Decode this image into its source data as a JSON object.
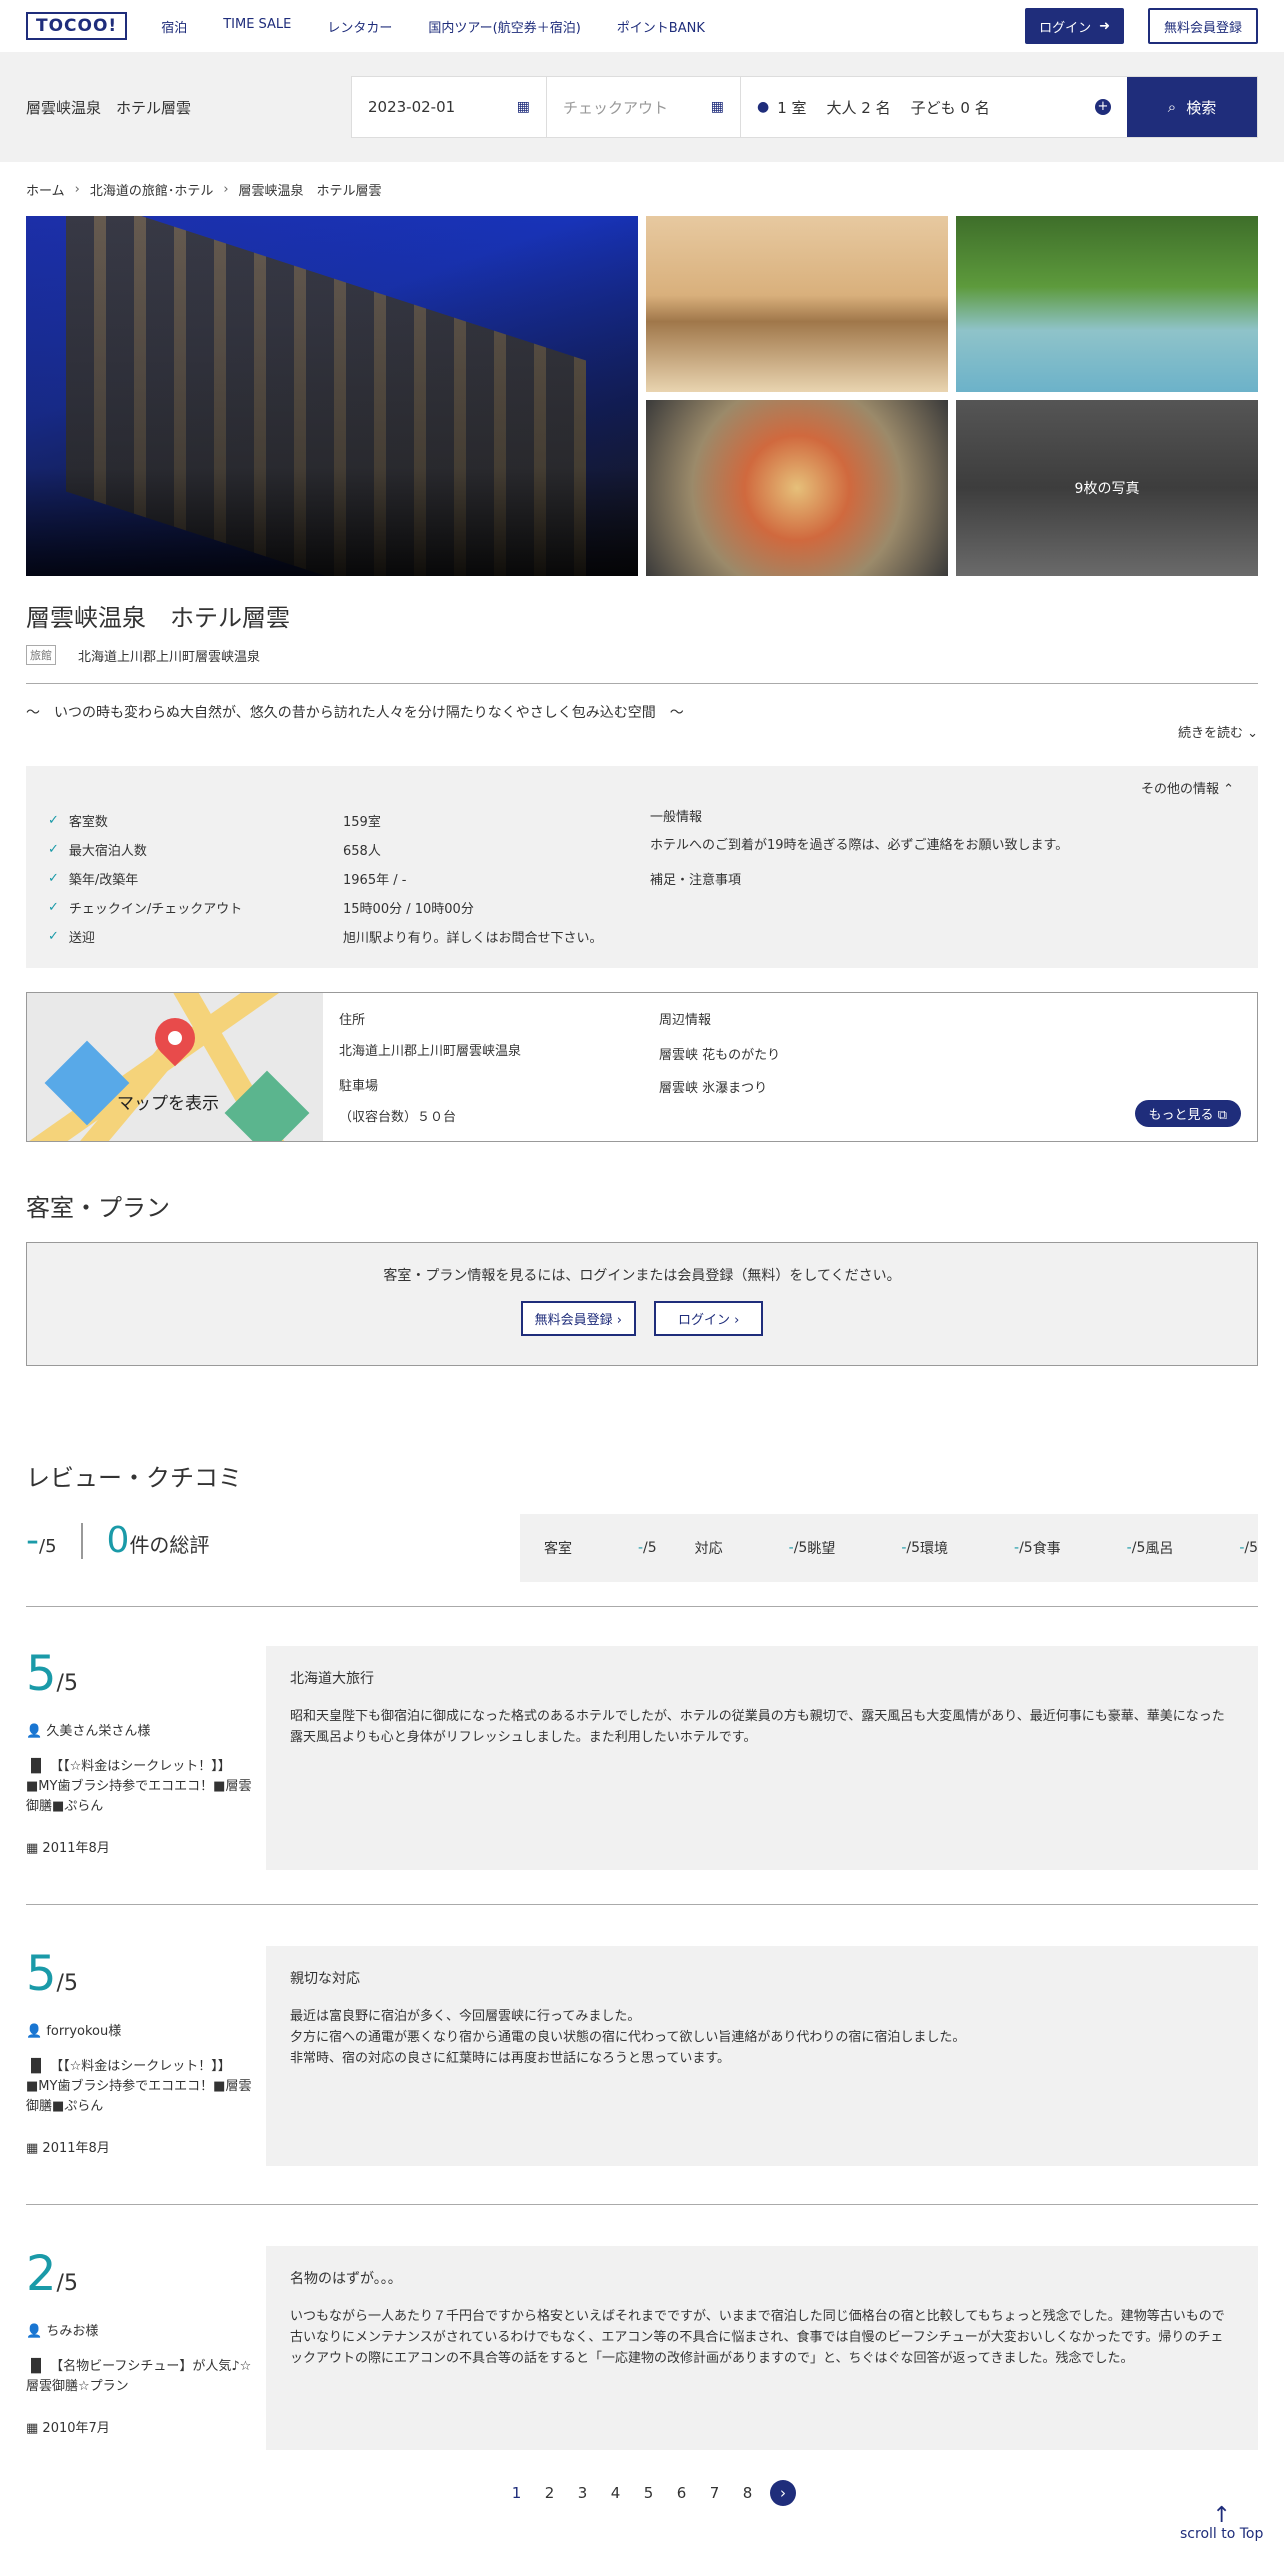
{
  "header": {
    "logo": "TOCOO!",
    "nav": [
      "宿泊",
      "TIME SALE",
      "レンタカー",
      "国内ツアー(航空券＋宿泊)",
      "ポイントBANK"
    ],
    "login": "ログイン",
    "signup": "無料会員登録"
  },
  "search": {
    "hotel": "層雲峡温泉　ホテル層雲",
    "checkin": "2023-02-01",
    "checkout_placeholder": "チェックアウト",
    "rooms": "1 室",
    "adults": "大人 2 名",
    "children": "子ども 0 名",
    "search_label": "検索"
  },
  "breadcrumb": [
    "ホーム",
    "北海道の旅館･ホテル",
    "層雲峡温泉　ホテル層雲"
  ],
  "photos": {
    "more_label": "9枚の写真"
  },
  "hotel": {
    "name": "層雲峡温泉　ホテル層雲",
    "type": "旅館",
    "address_short": "北海道上川郡上川町層雲峡温泉",
    "catch": "〜　いつの時も変わらぬ大自然が、悠久の昔から訪れた人々を分け隔たりなくやさしく包み込む空間　〜",
    "read_more": "続きを読む"
  },
  "info": {
    "other": "その他の情報",
    "specs": [
      {
        "k": "客室数",
        "v": "159室"
      },
      {
        "k": "最大宿泊人数",
        "v": "658人"
      },
      {
        "k": "築年/改築年",
        "v": "1965年 / -"
      },
      {
        "k": "チェックイン/チェックアウト",
        "v": "15時00分 / 10時00分"
      },
      {
        "k": "送迎",
        "v": "旭川駅より有り。詳しくはお問合せ下さい。"
      }
    ],
    "general_title": "一般情報",
    "general_text": "ホテルへのご到着が19時を過ぎる際は、必ずご連絡をお願い致します。",
    "notes_title": "補足・注意事項"
  },
  "map": {
    "show": "マップを表示",
    "addr_title": "住所",
    "addr": "北海道上川郡上川町層雲峡温泉",
    "parking_title": "駐車場",
    "parking": "（収容台数）５０台",
    "near_title": "周辺情報",
    "near": [
      "層雲峡 花ものがたり",
      "層雲峡 氷瀑まつり"
    ],
    "more": "もっと見る"
  },
  "plans": {
    "title": "客室・プラン",
    "msg": "客室・プラン情報を見るには、ログインまたは会員登録（無料）をしてください。",
    "signup": "無料会員登録",
    "login": "ログイン"
  },
  "reviews": {
    "title": "レビュー・クチコミ",
    "avg": "-",
    "of": "/5",
    "count": "0",
    "count_suffix": "件の総評",
    "categories": [
      {
        "k": "客室",
        "v": "-",
        "of": "/5"
      },
      {
        "k": "対応",
        "v": "-",
        "of": "/5"
      },
      {
        "k": "眺望",
        "v": "-",
        "of": "/5"
      },
      {
        "k": "環境",
        "v": "-",
        "of": "/5"
      },
      {
        "k": "食事",
        "v": "-",
        "of": "/5"
      },
      {
        "k": "風呂",
        "v": "-",
        "of": "/5"
      }
    ],
    "items": [
      {
        "score": "5",
        "of": "/5",
        "user": "久美さん栄さん様",
        "plan": "【【☆料金はシークレット！】】■MY歯ブラシ持参でエコエコ！■層雲御膳■ぷらん",
        "date": "2011年8月",
        "title": "北海道大旅行",
        "text": "昭和天皇陛下も御宿泊に御成になった格式のあるホテルでしたが、ホテルの従業員の方も親切で、露天風呂も大変風情があり、最近何事にも豪華、華美になった露天風呂よりも心と身体がリフレッシュしました。また利用したいホテルです。"
      },
      {
        "score": "5",
        "of": "/5",
        "user": "forryokou様",
        "plan": "【【☆料金はシークレット！】】■MY歯ブラシ持参でエコエコ！■層雲御膳■ぷらん",
        "date": "2011年8月",
        "title": "親切な対応",
        "text": "最近は富良野に宿泊が多く、今回層雲峡に行ってみました。\n夕方に宿への通電が悪くなり宿から通電の良い状態の宿に代わって欲しい旨連絡があり代わりの宿に宿泊しました。\n非常時、宿の対応の良さに紅葉時には再度お世話になろうと思っています。"
      },
      {
        "score": "2",
        "of": "/5",
        "user": "ちみお様",
        "plan": "【名物ビーフシチュー】が人気♪☆層雲御膳☆プラン",
        "date": "2010年7月",
        "title": "名物のはずが。。。",
        "text": "いつもながら一人あたり７千円台ですから格安といえばそれまでですが、いままで宿泊した同じ価格台の宿と比較してもちょっと残念でした。建物等古いもので古いなりにメンテナンスがされているわけでもなく、エアコン等の不具合に悩まされ、食事では自慢のビーフシチューが大変おいしくなかったです。帰りのチェックアウトの際にエアコンの不具合等の話をすると「一応建物の改修計画がありますので」と、ちぐはぐな回答が返ってきました。残念でした。"
      }
    ]
  },
  "pager": [
    "1",
    "2",
    "3",
    "4",
    "5",
    "6",
    "7",
    "8"
  ],
  "scroll_top": "scroll to Top",
  "colors": {
    "brand": "#1f2d7b",
    "accent": "#1a9aa8"
  }
}
